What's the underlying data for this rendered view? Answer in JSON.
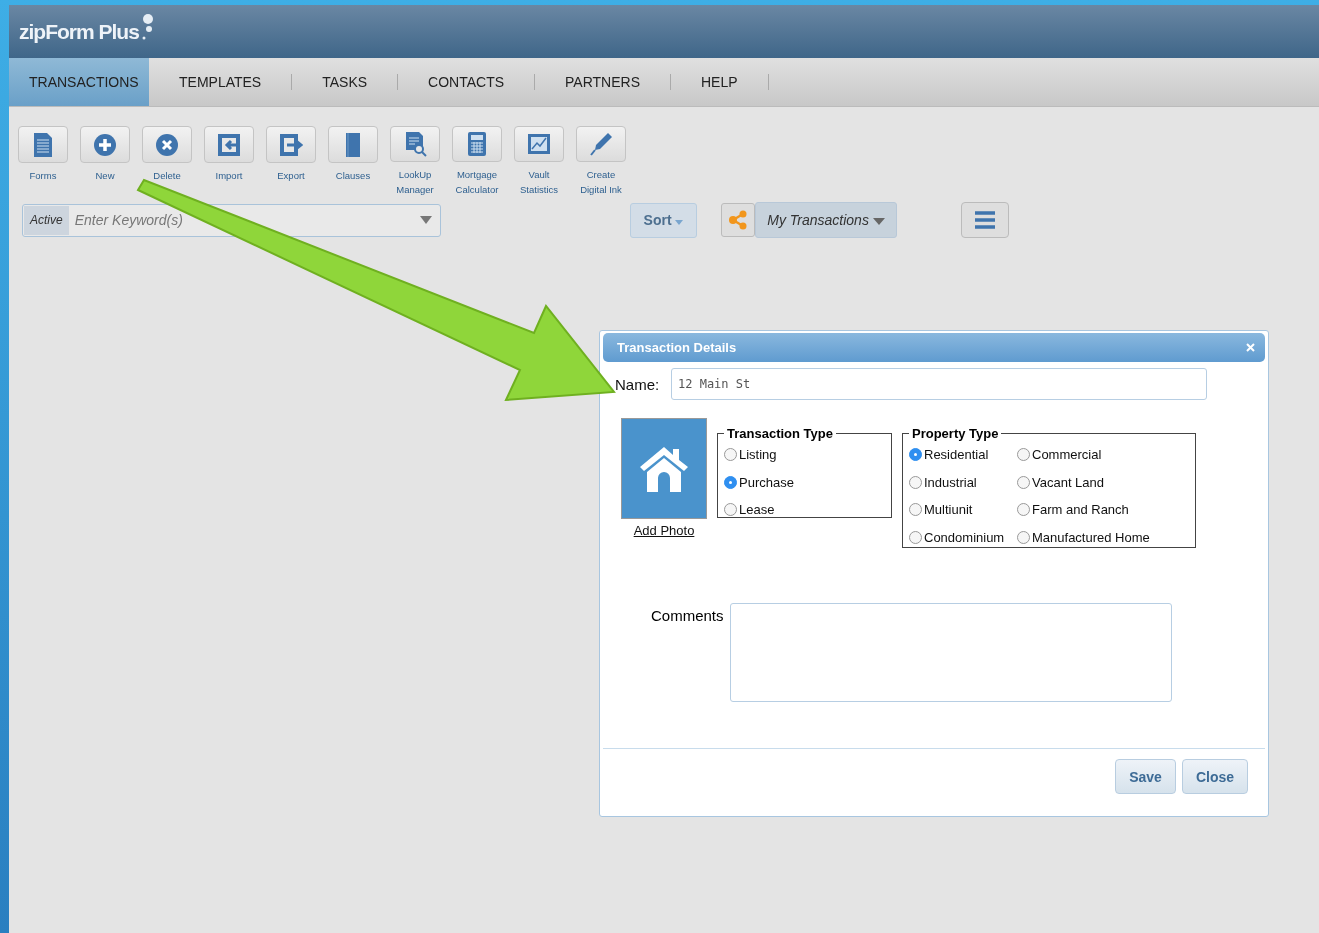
{
  "logo": {
    "text": "zipForm Plus"
  },
  "nav": [
    {
      "label": "TRANSACTIONS",
      "selected": true
    },
    {
      "label": "TEMPLATES",
      "selected": false
    },
    {
      "label": "TASKS",
      "selected": false
    },
    {
      "label": "CONTACTS",
      "selected": false
    },
    {
      "label": "PARTNERS",
      "selected": false
    },
    {
      "label": "HELP",
      "selected": false
    }
  ],
  "toolbar": [
    {
      "label": "Forms"
    },
    {
      "label": "New"
    },
    {
      "label": "Delete"
    },
    {
      "label": "Import"
    },
    {
      "label": "Export"
    },
    {
      "label": "Clauses"
    },
    {
      "label": "LookUp Manager"
    },
    {
      "label": "Mortgage Calculator"
    },
    {
      "label": "Vault Statistics"
    },
    {
      "label": "Create Digital Ink"
    }
  ],
  "search": {
    "filter": "Active",
    "placeholder": "Enter Keyword(s)"
  },
  "sort_button": "Sort",
  "view_dropdown": "My Transactions",
  "dialog": {
    "title": "Transaction Details",
    "name_label": "Name:",
    "name_value": "12 Main St",
    "add_photo": "Add Photo",
    "transaction_type": {
      "legend": "Transaction Type",
      "options": [
        {
          "label": "Listing",
          "selected": false
        },
        {
          "label": "Purchase",
          "selected": true
        },
        {
          "label": "Lease",
          "selected": false
        }
      ]
    },
    "property_type": {
      "legend": "Property Type",
      "options": [
        {
          "label": "Residential",
          "selected": true
        },
        {
          "label": "Commercial",
          "selected": false
        },
        {
          "label": "Industrial",
          "selected": false
        },
        {
          "label": "Vacant Land",
          "selected": false
        },
        {
          "label": "Multiunit",
          "selected": false
        },
        {
          "label": "Farm and Ranch",
          "selected": false
        },
        {
          "label": "Condominium",
          "selected": false
        },
        {
          "label": "Manufactured Home",
          "selected": false
        }
      ]
    },
    "comments_label": "Comments",
    "buttons": [
      "Save",
      "Close"
    ]
  }
}
